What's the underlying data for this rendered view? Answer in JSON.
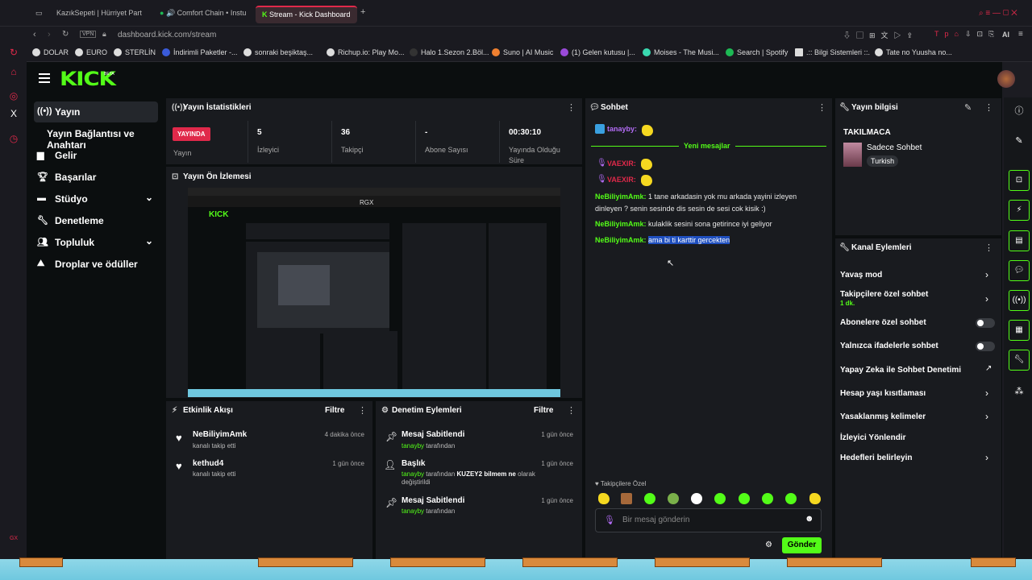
{
  "browser": {
    "tabs": [
      {
        "label": "KazıkSepeti | Hürriyet Part"
      },
      {
        "label": "🔊 Comfort Chain • Instu"
      },
      {
        "label": "Stream - Kick Dashboard"
      }
    ],
    "url": "dashboard.kick.com/stream",
    "vpn": "VPN",
    "bookmarks": [
      "DOLAR",
      "EURO",
      "STERLİN",
      "İndirimli Paketler -...",
      "sonraki beşiktaş...",
      "Richup.io: Play Mo...",
      "Halo 1.Sezon 2.Böl...",
      "Suno | AI Music",
      "(1) Gelen kutusu |...",
      "Moises - The Musi...",
      "Search | Spotify",
      ".:: Bilgi Sistemleri ::.",
      "Tate no Yuusha no..."
    ],
    "ai_label": "AI"
  },
  "kick": {
    "logo": "KICK",
    "beta": "BETA"
  },
  "nav": {
    "items": [
      {
        "label": "Yayın"
      },
      {
        "label": "Yayın Bağlantısı ve Anahtarı"
      },
      {
        "label": "Gelir"
      },
      {
        "label": "Başarılar"
      },
      {
        "label": "Stüdyo"
      },
      {
        "label": "Denetleme"
      },
      {
        "label": "Topluluk"
      },
      {
        "label": "Droplar ve ödüller"
      }
    ]
  },
  "stats": {
    "title": "Yayın İstatistikleri",
    "live_badge": "YAYINDA",
    "live_label": "Yayın",
    "viewers": "5",
    "viewers_label": "İzleyici",
    "followers": "36",
    "followers_label": "Takipçi",
    "subs": "-",
    "subs_label": "Abone Sayısı",
    "uptime": "00:30:10",
    "uptime_label": "Yayında Olduğu Süre"
  },
  "preview": {
    "title": "Yayın Ön İzlemesi",
    "rgx": "RGX"
  },
  "activity": {
    "title": "Etkinlik Akışı",
    "filter": "Filtre",
    "items": [
      {
        "name": "NeBiliyimAmk",
        "sub": "kanalı takip etti",
        "time": "4 dakika önce"
      },
      {
        "name": "kethud4",
        "sub": "kanalı takip etti",
        "time": "1 gün önce"
      }
    ]
  },
  "moderation": {
    "title": "Denetim Eylemleri",
    "filter": "Filtre",
    "items": [
      {
        "name": "Mesaj Sabitlendi",
        "user": "tanayby",
        "rest": "tarafından",
        "time": "1 gün önce"
      },
      {
        "name": "Başlık",
        "user": "tanayby",
        "rest": "tarafından",
        "highlight": "KUZEY2 bilmem ne",
        "rest2": "olarak değiştirildi",
        "time": "1 gün önce"
      },
      {
        "name": "Mesaj Sabitlendi",
        "user": "tanayby",
        "rest": "tarafından",
        "time": "1 gün önce"
      }
    ]
  },
  "chat": {
    "title": "Sohbet",
    "pinned_user": "tanayby:",
    "new_messages": "Yeni mesajlar",
    "vaexir": "VAEXIR:",
    "messages": [
      {
        "user": "NeBiliyimAmk:",
        "text": "1 tane arkadasin yok mu arkada yayini izleyen dinleyen ? senin sesinde dis sesin de sesi cok kisik :)"
      },
      {
        "user": "NeBiliyimAmk:",
        "text": "kulaklik sesini sona getirince iyi geliyor"
      },
      {
        "user": "NeBiliyimAmk:",
        "text": "ama bi ti karttir gercekten"
      }
    ],
    "followers_only": "Takipçilere Özel",
    "placeholder": "Bir mesaj gönderin",
    "send": "Gönder"
  },
  "stream_info": {
    "title": "Yayın bilgisi",
    "category_label": "TAKILMACA",
    "category": "Sadece Sohbet",
    "language": "Turkish"
  },
  "channel_actions": {
    "title": "Kanal Eylemleri",
    "slow": "Yavaş mod",
    "followers_chat": "Takipçilere özel sohbet",
    "followers_chat_sub": "1 dk.",
    "subs_chat": "Abonelere özel sohbet",
    "emote_chat": "Yalnızca ifadelerle sohbet",
    "ai_mod": "Yapay Zeka ile Sohbet Denetimi",
    "age": "Hesap yaşı kısıtlaması",
    "banned": "Yasaklanmış kelimeler",
    "redirect": "İzleyici Yönlendir",
    "goals": "Hedefleri belirleyin"
  },
  "colors": {
    "accent": "#53fc18",
    "live": "#e0294a",
    "bg": "#0b0e0f",
    "panel": "#191b1f"
  }
}
